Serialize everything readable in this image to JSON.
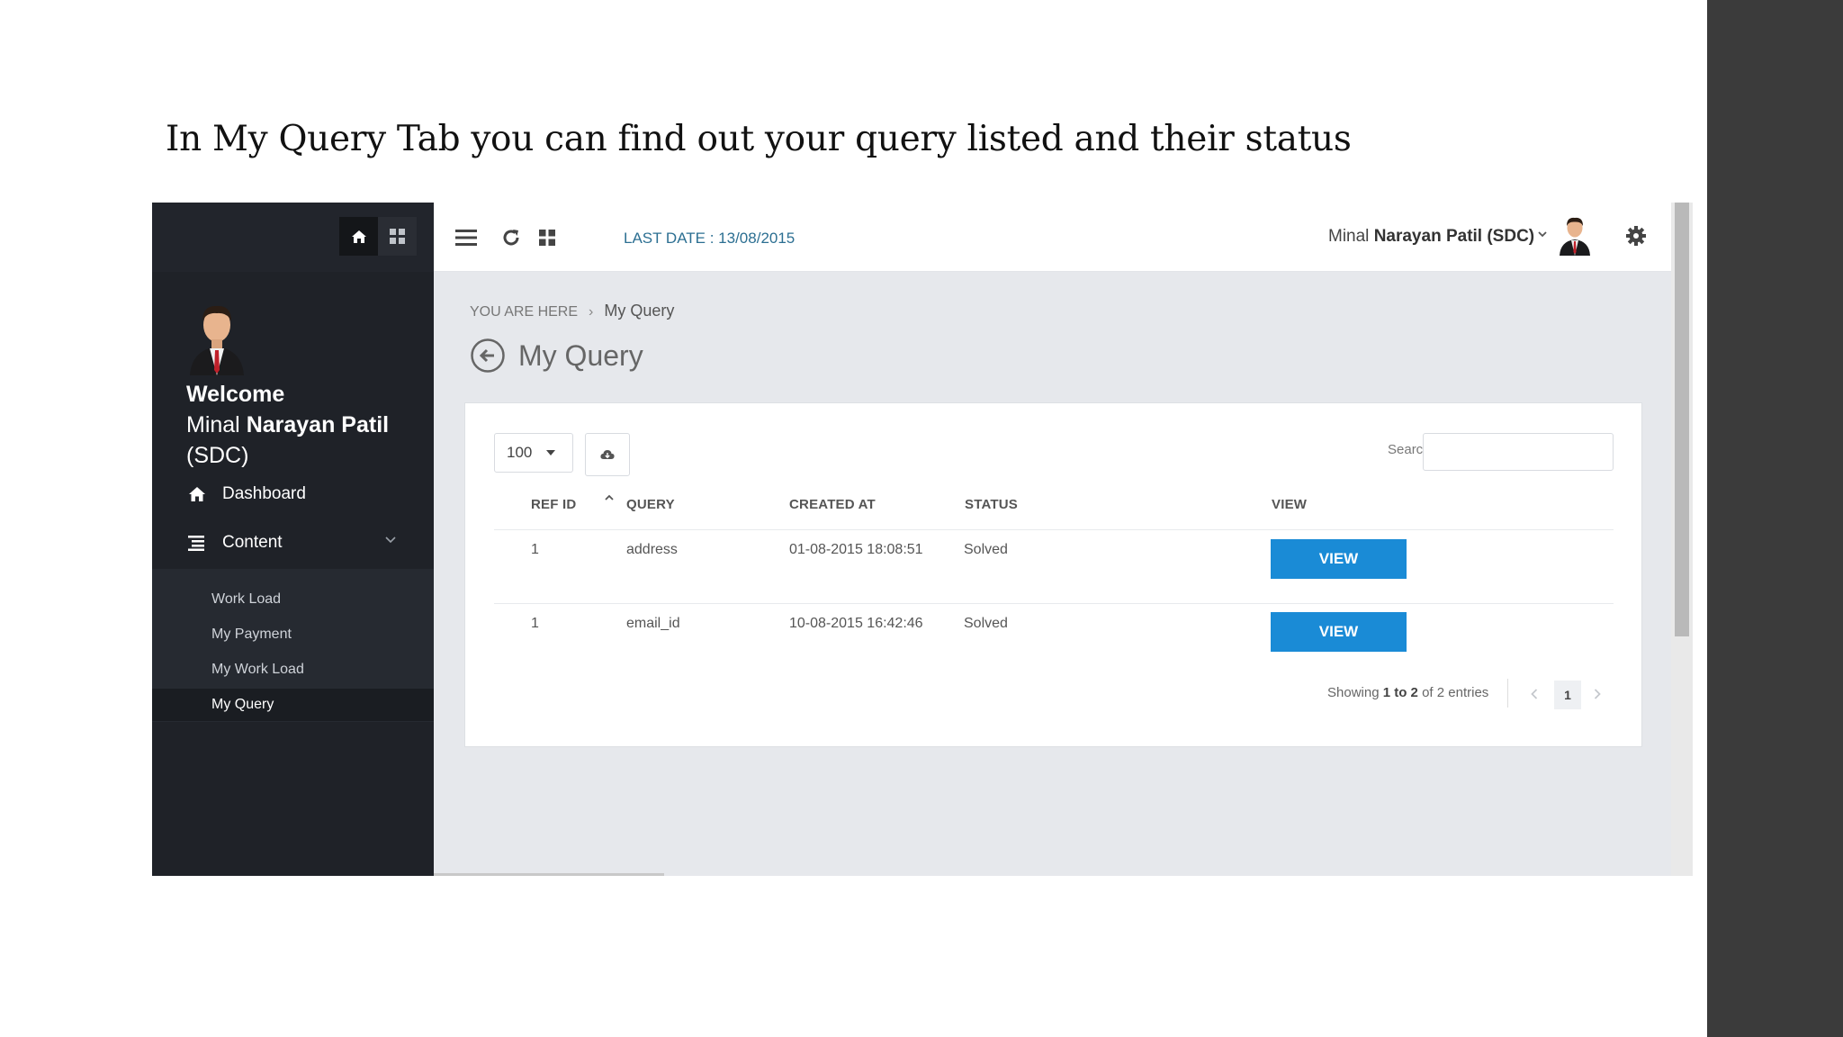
{
  "slide": {
    "title": "In My Query Tab you can find out your query listed and their status"
  },
  "sidebar": {
    "welcome_line": "Welcome",
    "user_first": "Minal ",
    "user_bold": "Narayan Patil",
    "user_suffix": "(SDC)",
    "nav": [
      {
        "label": "Dashboard",
        "icon": "home-icon"
      },
      {
        "label": "Content",
        "icon": "list-icon"
      }
    ],
    "submenu": [
      "Work Load",
      "My Payment",
      "My Work Load",
      "My Query"
    ],
    "active_submenu": "My Query"
  },
  "topbar": {
    "last_date": "LAST DATE : 13/08/2015",
    "user_first": "Minal ",
    "user_bold": "Narayan Patil (SDC)"
  },
  "breadcrumb": {
    "prefix": "YOU ARE HERE",
    "separator": "›",
    "current": "My Query"
  },
  "page": {
    "title": "My Query"
  },
  "table_controls": {
    "page_length": "100",
    "search_label": "Search:",
    "search_value": ""
  },
  "table": {
    "columns": [
      "REF ID",
      "QUERY",
      "CREATED AT",
      "STATUS",
      "VIEW"
    ],
    "rows": [
      {
        "ref_id": "1",
        "query": "address",
        "created_at": "01-08-2015 18:08:51",
        "status": "Solved",
        "view": "VIEW"
      },
      {
        "ref_id": "1",
        "query": "email_id",
        "created_at": "10-08-2015 16:42:46",
        "status": "Solved",
        "view": "VIEW"
      }
    ]
  },
  "pagination": {
    "info_prefix": "Showing ",
    "info_range": "1 to 2",
    "info_suffix": " of 2 entries",
    "current_page": "1"
  },
  "colors": {
    "accent": "#1a8bd6",
    "sidebar_bg": "#1f2228",
    "last_date": "#2c6f92"
  }
}
